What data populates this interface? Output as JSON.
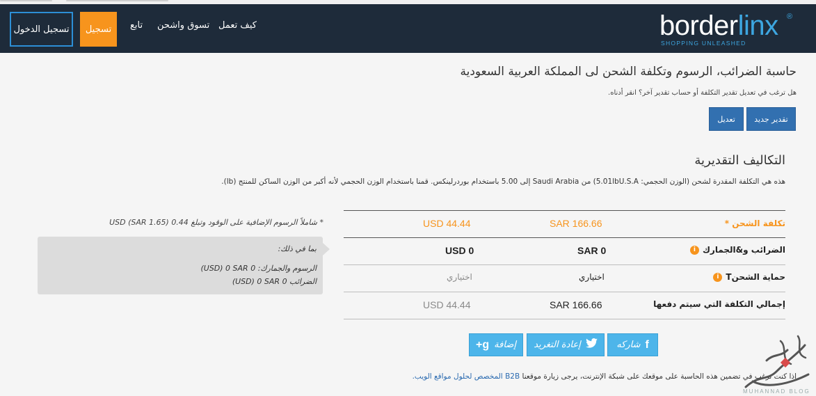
{
  "header": {
    "logo_main": "border",
    "logo_accent": "linx",
    "logo_reg": "®",
    "logo_tagline": "SHOPPING UNLEASHED",
    "nav": {
      "how_it_works": "كيف تعمل",
      "shop_ship": "تسوق واشحن",
      "track": "تابع",
      "register": "تسجيل",
      "login": "تسجيل الدخول"
    },
    "colors": {
      "bg": "#1e2b3a",
      "accent": "#3da6e0",
      "register_bg": "#f7941d",
      "login_border": "#2d8fd6"
    }
  },
  "main": {
    "title": "حاسبة الضرائب، الرسوم وتكلفة الشحن لى المملكة العربية السعودية",
    "subtitle": "هل ترغب في تعديل تقدير التكلفة أو حساب تقدير آخر؟ انقر أدناه.",
    "buttons": {
      "new_estimate": "تقدير جديد",
      "edit": "تعديل"
    },
    "section_title": "التكاليف التقديرية",
    "description": "هذه هي التكلفة المقدرة لشحن (الوزن الحجمي: 5.01lbU.S.A) من Saudi Arabia إلى 5.00 باستخدام بوردرلينكس. قمنا باستخدام الوزن الحجمي لأنه أكبر من الوزن الساكن للمنتج (lb)."
  },
  "table": {
    "rows": [
      {
        "label": "تكلفة الشحن *",
        "sar": "SAR 166.66",
        "usd": "USD 44.44",
        "info": false
      },
      {
        "label": "الضرائب و&الجمارك",
        "sar": "SAR 0",
        "usd": "USD 0",
        "info": true
      },
      {
        "label": "حماية الشحنT",
        "sar": "اختياري",
        "usd": "اختياري",
        "info": true
      },
      {
        "label": "إجمالي التكلفة التي سيتم دفعها",
        "sar": "SAR 166.66",
        "usd": "USD 44.44",
        "info": false
      }
    ],
    "note": "* شاملاً الرسوم الإضافية على الوقود وتبلغ 0.44 USD (SAR 1.65)",
    "tooltip": {
      "heading": "بما في ذلك:",
      "line1": "الرسوم والجمارك: 0 USD) 0 SAR)",
      "line2": "الضرائب 0 USD) 0 SAR)"
    },
    "colors": {
      "shipping_cost": "#f7941d"
    }
  },
  "share": {
    "facebook": "شاركه",
    "twitter": "إعادة التغريد",
    "gplus": "إضافة",
    "facebook_icon": "f",
    "twitter_icon": "twitter-bird-icon",
    "gplus_icon": "g+",
    "color": "#4db5ea"
  },
  "footer": {
    "text_before": "إذا كنت ترغب في تضمين هذه الحاسبة على موقعك على شبكة الإنترنت، يرجى زيارة موقعنا",
    "link": "B2B المخصص لحلول مواقع الويب."
  },
  "watermark": {
    "text": "MUHANNAD BLOG"
  }
}
